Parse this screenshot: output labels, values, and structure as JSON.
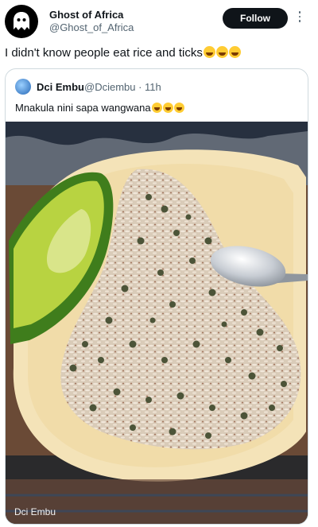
{
  "author": {
    "name": "Ghost of Africa",
    "handle": "@Ghost_of_Africa"
  },
  "follow_label": "Follow",
  "tweet_text": "I didn't know people eat rice and ticks",
  "quoted": {
    "name": "Dci Embu",
    "handle": "@Dciembu · 11h",
    "text": "Mnakula nini sapa wangwana",
    "photo_credit": "Dci Embu"
  },
  "icons": [
    "ghost-avatar-icon",
    "more-options-icon",
    "laughing-emoji-icon",
    "grinning-emoji-icon"
  ]
}
